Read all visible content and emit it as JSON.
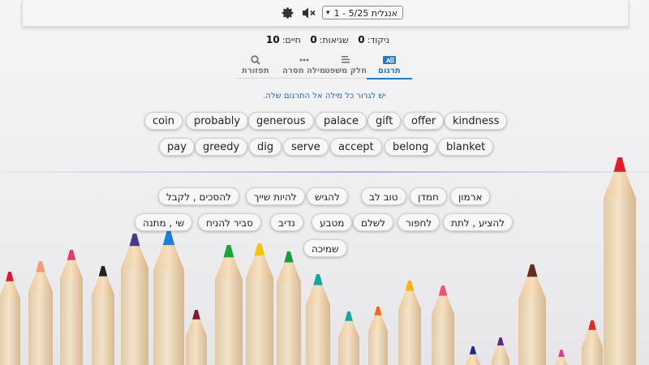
{
  "toolbar": {
    "settings_icon": "gear-icon",
    "sound_icon": "speaker-muted-icon",
    "lesson_select": "אנגלית 5/25 - 1",
    "select_arrow": "▾"
  },
  "stats": {
    "score_label": "ניקוד:",
    "score_value": "0",
    "errors_label": "שגיאות:",
    "errors_value": "0",
    "lives_label": "חיים:",
    "lives_value": "10"
  },
  "tabs": [
    {
      "label": "תרגום",
      "icon": "translate-icon",
      "active": true
    },
    {
      "label": "חלק משפט",
      "icon": "text-lines-icon",
      "active": false
    },
    {
      "label": "מילה חסרה",
      "icon": "dots-icon",
      "active": false
    },
    {
      "label": "תפזורת",
      "icon": "search-icon",
      "active": false
    }
  ],
  "instruction": "יש לגרור כל מילה אל התרגום שלה.",
  "english_words": [
    "coin",
    "probably",
    "generous",
    "palace",
    "gift",
    "offer",
    "kindness",
    "pay",
    "greedy",
    "dig",
    "serve",
    "accept",
    "belong",
    "blanket"
  ],
  "hebrew_words": [
    "ארמון",
    "חמדן",
    "טוב לב",
    "להגיש",
    "להיות שייך",
    "להסכים , לקבל",
    "להציע , לתת",
    "לחפור",
    "לשלם",
    "מטבע",
    "נדיב",
    "סביר להניח",
    "שי , מתנה",
    "שמיכה"
  ],
  "colors": {
    "accent": "#2a7ac2",
    "instruction": "#2a63b8",
    "divider": "#b9a8e8"
  }
}
